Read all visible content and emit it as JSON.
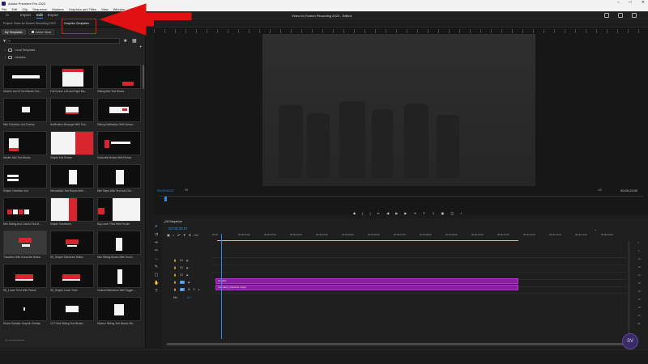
{
  "titlebar": {
    "title": "Adobe Premiere Pro 2023"
  },
  "menu": {
    "items": [
      "File",
      "Edit",
      "Clip",
      "Sequence",
      "Markers",
      "Graphics and Titles",
      "View",
      "Window",
      "Help"
    ]
  },
  "header": {
    "workspaces": [
      "Import",
      "Edit",
      "Export"
    ],
    "active_workspace": "Edit",
    "document_title": "Video for Screen Recording 2023 - Edited"
  },
  "left_panel": {
    "tabs": [
      "Project: Video for Screen Recording 2023",
      "Graphics Templates"
    ],
    "subtabs": [
      "My Templates",
      "Adobe Stock"
    ],
    "search_placeholder": "",
    "tree": [
      "Local Templates",
      "Libraries"
    ],
    "templates": [
      "Modern List Of Text Blocks Ove...",
      "Full Screen Left and Right Blo...",
      "Sliding Mini Text Blocks",
      "Mini Checkbox List Overlay",
      "Notification Message With Text...",
      "Sliding Notification With Subscr...",
      "Hidden Mini Text Blocks",
      "Simple End Screen",
      "Subscribe Button With Picture",
      "Simple Checkbox List",
      "Minimalistic Text Blocks With ...",
      "Mini Steps With Text And Che...",
      "Mini Sliding And Colorful Text B...",
      "Simple Transitions",
      "Big Lower Third With Picture",
      "Transition With Subscribe Button",
      "SE_Simple Subscribe Button",
      "Mini Sliding Blocks With Text A...",
      "SE_Lower Third With Picture",
      "SE_Simple Lower Third",
      "Vertical Milestones With Toggle...",
      "Phone Rotation Graphic Overlay",
      "CCT Mini Sliding Text Blocks",
      "Modern Sliding Text Blocks Wit..."
    ]
  },
  "monitor": {
    "timecode": "00;00;00;07",
    "fit": "Fit",
    "resolution": "1/2",
    "duration": "00;00;12;00"
  },
  "timeline": {
    "sequence_tab": "V6 Sequence",
    "timecode": "00;00;00;07",
    "ruler_ticks": [
      "00;00",
      "00;00;01;00",
      "00;00;02;00",
      "00;00;03;00",
      "00;00;04;00",
      "00;00;05;00",
      "00;00;06;00",
      "00;00;07;00",
      "00;00;08;00",
      "00;00;09;00",
      "00;00;10;00",
      "00;00;11;00",
      "00;00;12;00",
      "00;00;13;00",
      "00;00;14;00",
      "00;00;15;00"
    ],
    "tracks": [
      {
        "name": "V4",
        "label": "V4"
      },
      {
        "name": "V3",
        "label": "V3"
      },
      {
        "name": "V2",
        "label": "V2"
      },
      {
        "name": "V1",
        "label": "V1"
      },
      {
        "name": "A1",
        "label": "A1"
      }
    ],
    "master_label": "Mix",
    "master_value": "0.0",
    "clips": [
      {
        "label": "Graphic",
        "track": "V2"
      },
      {
        "label": "Animated_Infocircle.mogrt",
        "track": "V1"
      }
    ]
  },
  "colors": {
    "accent": "#2d8ceb",
    "clip": "#8b1fa4",
    "annotation": "#e11111"
  }
}
